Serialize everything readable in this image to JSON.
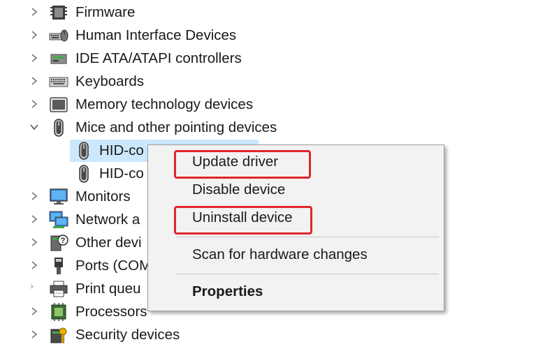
{
  "tree": {
    "items": [
      {
        "label": "Firmware",
        "icon": "firmware-icon",
        "expanded": false
      },
      {
        "label": "Human Interface Devices",
        "icon": "hid-icon",
        "expanded": false
      },
      {
        "label": "IDE ATA/ATAPI controllers",
        "icon": "ide-controller-icon",
        "expanded": false
      },
      {
        "label": "Keyboards",
        "icon": "keyboard-icon",
        "expanded": false
      },
      {
        "label": "Memory technology devices",
        "icon": "memory-icon",
        "expanded": false
      },
      {
        "label": "Mice and other pointing devices",
        "icon": "mouse-icon",
        "expanded": true
      },
      {
        "label": "HID-co",
        "icon": "mouse-icon",
        "child": true,
        "selected": true
      },
      {
        "label": "HID-co",
        "icon": "mouse-icon",
        "child": true
      },
      {
        "label": "Monitors",
        "icon": "monitor-icon",
        "expanded": false
      },
      {
        "label": "Network a",
        "icon": "network-icon",
        "expanded": false
      },
      {
        "label": "Other devi",
        "icon": "other-devices-icon",
        "expanded": false
      },
      {
        "label": "Ports (COM",
        "icon": "port-icon",
        "expanded": false
      },
      {
        "label": "Print queu",
        "icon": "printer-icon",
        "expanded": false
      },
      {
        "label": "Processors",
        "icon": "processor-icon",
        "expanded": false
      },
      {
        "label": "Security devices",
        "icon": "security-icon",
        "expanded": false
      }
    ]
  },
  "context_menu": {
    "update_driver": "Update driver",
    "disable_device": "Disable device",
    "uninstall_device": "Uninstall device",
    "scan_hardware": "Scan for hardware changes",
    "properties": "Properties"
  },
  "colors": {
    "highlight_box": "#e0262b",
    "selection": "#cce8ff",
    "menu_bg": "#f2f2f2"
  }
}
